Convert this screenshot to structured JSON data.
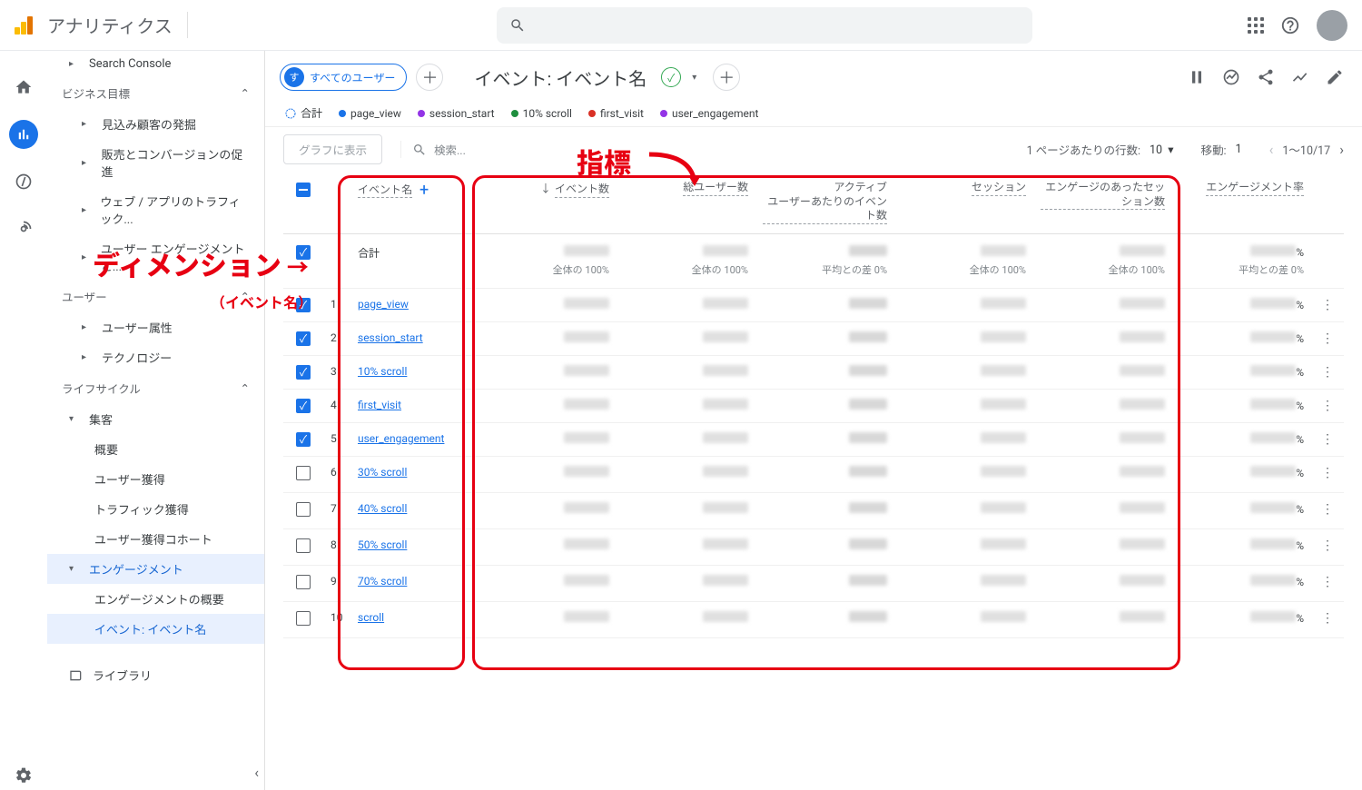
{
  "header": {
    "app_title": "アナリティクス"
  },
  "sidebar": {
    "sc": "Search Console",
    "biz_section": "ビジネス目標",
    "biz_items": [
      "見込み顧客の発掘",
      "販売とコンバージョンの促進",
      "ウェブ / アプリのトラフィック...",
      "ユーザー エンゲージメントと..."
    ],
    "user_section": "ユーザー",
    "user_items": [
      "ユーザー属性",
      "テクノロジー"
    ],
    "life_section": "ライフサイクル",
    "acq": "集客",
    "acq_items": [
      "概要",
      "ユーザー獲得",
      "トラフィック獲得",
      "ユーザー獲得コホート"
    ],
    "eng": "エンゲージメント",
    "eng_items": [
      "エンゲージメントの概要",
      "イベント: イベント名"
    ],
    "library": "ライブラリ"
  },
  "toolbar": {
    "chip_initial": "す",
    "chip_label": "すべてのユーザー",
    "title": "イベント: イベント名"
  },
  "legend": {
    "total": "合計",
    "series": [
      {
        "label": "page_view",
        "color": "#1a73e8"
      },
      {
        "label": "session_start",
        "color": "#9334e6"
      },
      {
        "label": "10% scroll",
        "color": "#1e8e3e"
      },
      {
        "label": "first_visit",
        "color": "#d93025"
      },
      {
        "label": "user_engagement",
        "color": "#9334e6"
      }
    ]
  },
  "controls": {
    "graph_btn": "グラフに表示",
    "search_ph": "検索...",
    "rows_label": "1 ページあたりの行数:",
    "rows_value": "10",
    "goto_label": "移動:",
    "goto_value": "1",
    "range": "1～10/17"
  },
  "table": {
    "dim_header": "イベント名",
    "metrics": [
      "イベント数",
      "総ユーザー数",
      "アクティブ ユーザーあたりのイベント数",
      "セッション",
      "エンゲージのあったセッション数",
      "エンゲージメント率"
    ],
    "total_label": "合計",
    "sublabels": [
      "全体の 100%",
      "全体の 100%",
      "平均との差 0%",
      "全体の 100%",
      "全体の 100%",
      "平均との差 0%"
    ],
    "rows": [
      {
        "n": 1,
        "name": "page_view",
        "checked": true
      },
      {
        "n": 2,
        "name": "session_start",
        "checked": true
      },
      {
        "n": 3,
        "name": "10% scroll",
        "checked": true
      },
      {
        "n": 4,
        "name": "first_visit",
        "checked": true
      },
      {
        "n": 5,
        "name": "user_engagement",
        "checked": true
      },
      {
        "n": 6,
        "name": "30% scroll",
        "checked": false
      },
      {
        "n": 7,
        "name": "40% scroll",
        "checked": false
      },
      {
        "n": 8,
        "name": "50% scroll",
        "checked": false
      },
      {
        "n": 9,
        "name": "70% scroll",
        "checked": false
      },
      {
        "n": 10,
        "name": "scroll",
        "checked": false
      }
    ]
  },
  "annotations": {
    "dimension": "ディメンション",
    "dimension_sub": "（イベント名）",
    "metric": "指標"
  }
}
